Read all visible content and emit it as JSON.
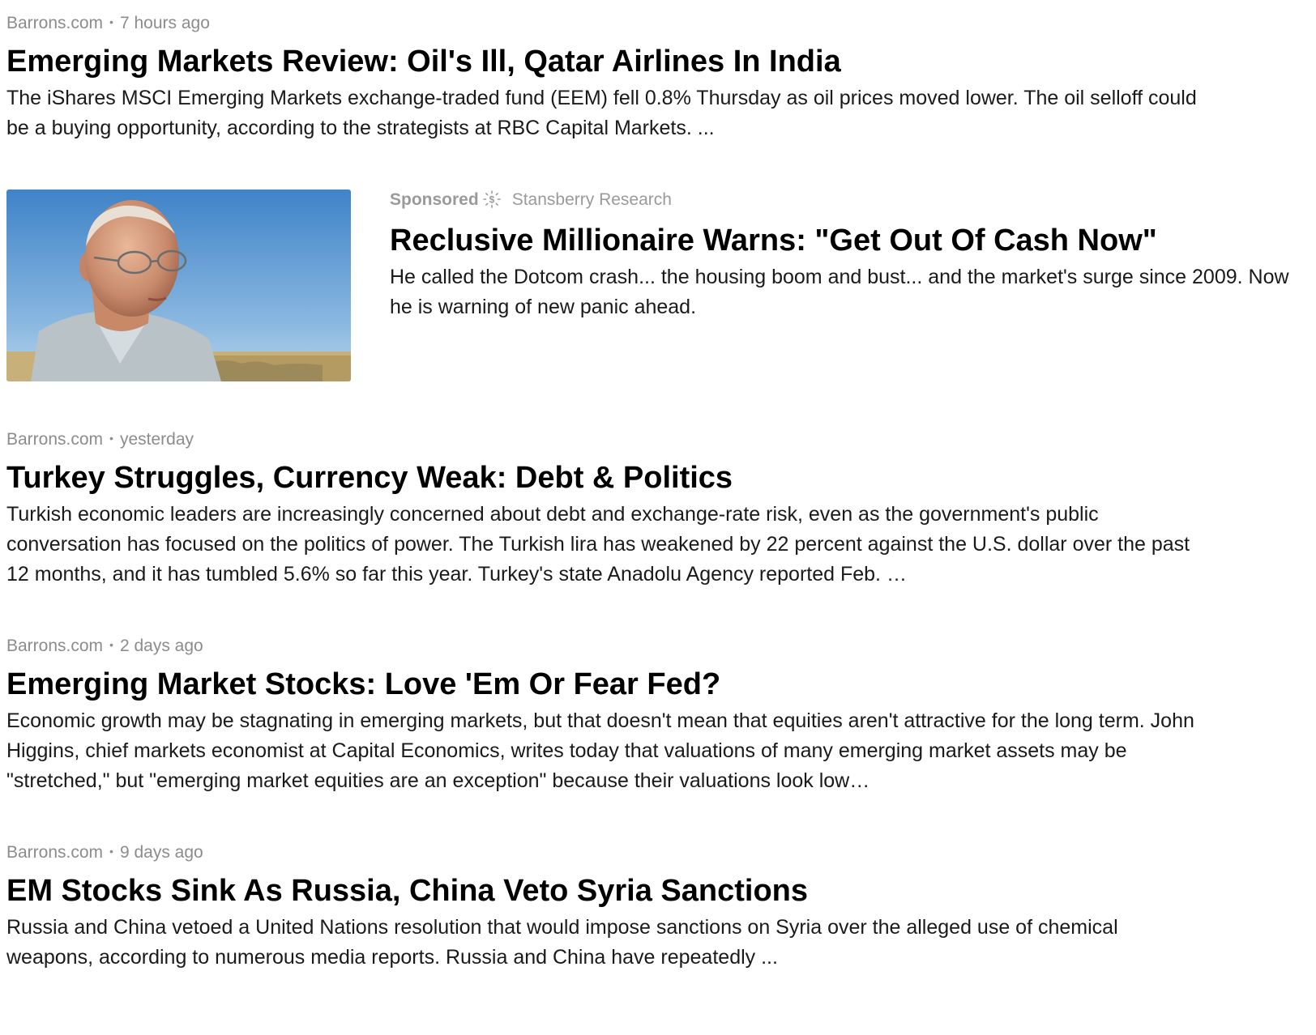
{
  "articles_top": [
    {
      "source": "Barrons.com",
      "time": "7 hours ago",
      "title": "Emerging Markets Review: Oil's Ill, Qatar Airlines In India",
      "summary": "The iShares MSCI Emerging Markets exchange-traded fund (EEM) fell 0.8% Thursday as oil prices moved lower. The oil selloff could be a buying opportunity, according to the strategists at RBC Capital Markets. ..."
    }
  ],
  "sponsored": {
    "label": "Sponsored",
    "icon": "sponsored-dollar-sun-icon",
    "advertiser": "Stansberry Research",
    "title": "Reclusive Millionaire Warns: \"Get Out Of Cash Now\"",
    "summary": "He called the Dotcom crash... the housing boom and bust... and the market's surge since 2009. Now he is warning of new panic ahead."
  },
  "articles": [
    {
      "source": "Barrons.com",
      "time": "yesterday",
      "title": "Turkey Struggles, Currency Weak: Debt & Politics",
      "summary": "Turkish economic leaders are increasingly concerned about debt and exchange-rate risk, even as the government's public conversation has focused on the politics of power. The Turkish lira has weakened by 22 percent against the U.S. dollar over the past 12 months, and it has tumbled 5.6% so far this year. Turkey's state Anadolu Agency reported Feb. …"
    },
    {
      "source": "Barrons.com",
      "time": "2 days ago",
      "title": "Emerging Market Stocks: Love 'Em Or Fear Fed?",
      "summary": "Economic growth may be stagnating in emerging markets, but that doesn't mean that equities aren't attractive for the long term. John Higgins, chief markets economist at Capital Economics, writes today that valuations of many emerging market assets may be \"stretched,\" but \"emerging market equities are an exception\" because their valuations look low…"
    },
    {
      "source": "Barrons.com",
      "time": "9 days ago",
      "title": "EM Stocks Sink As Russia, China Veto Syria Sanctions",
      "summary": "Russia and China vetoed a United Nations resolution that would impose sanctions on Syria over the alleged use of chemical weapons, according to numerous media reports. Russia and China have repeatedly ..."
    }
  ],
  "separator": "•"
}
